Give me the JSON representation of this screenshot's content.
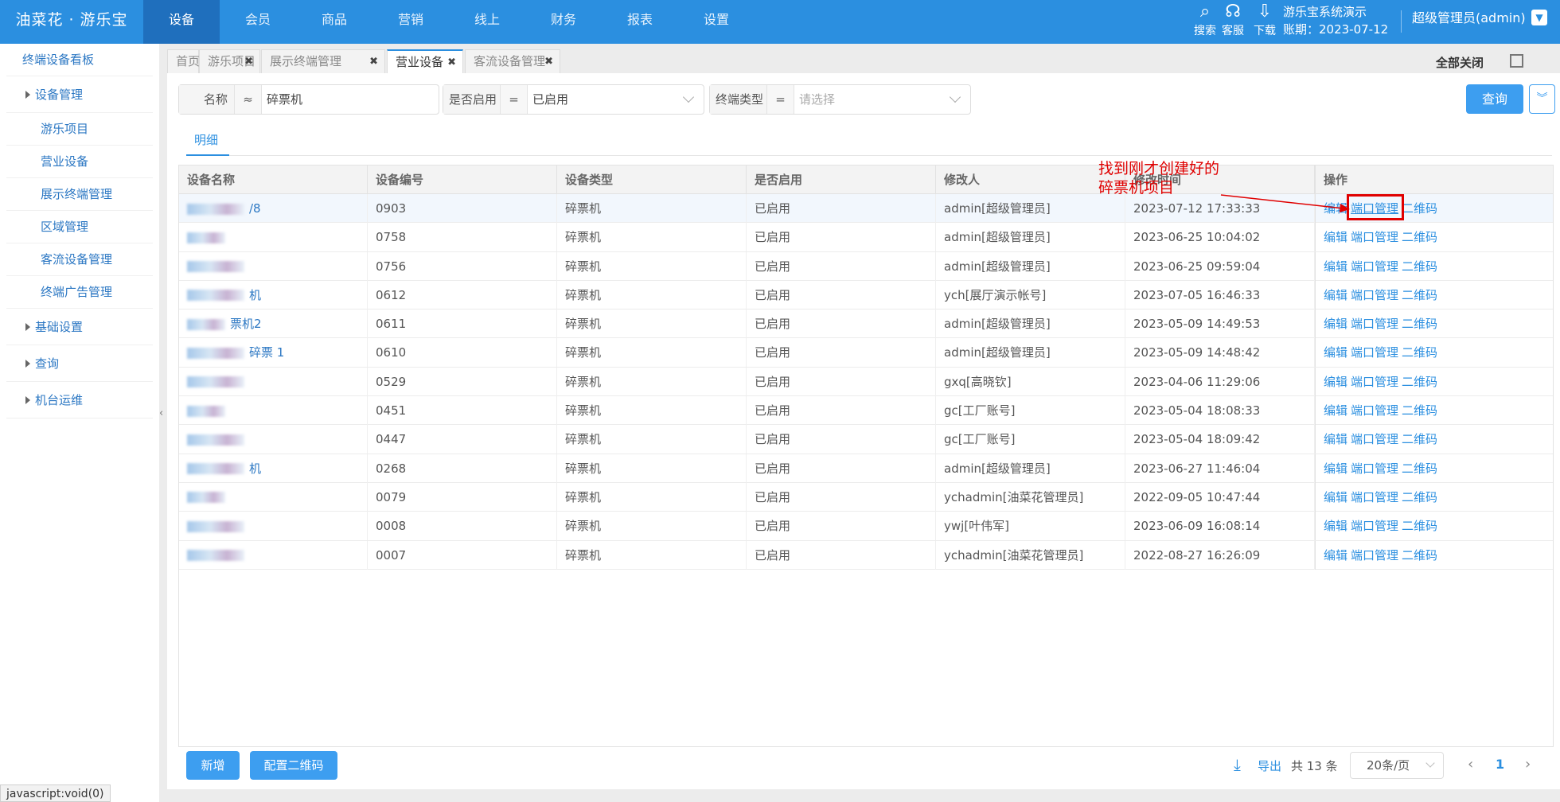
{
  "header": {
    "logo": "油菜花 · 游乐宝",
    "nav": [
      "设备",
      "会员",
      "商品",
      "营销",
      "线上",
      "财务",
      "报表",
      "设置"
    ],
    "active_nav": "设备",
    "tools": [
      {
        "icon": "search-icon",
        "label": "搜索"
      },
      {
        "icon": "headset-icon",
        "label": "客服"
      },
      {
        "icon": "download-icon",
        "label": "下载"
      }
    ],
    "system_name": "游乐宝系统演示",
    "account_period": "账期：2023-07-12",
    "user": "超级管理员(admin)"
  },
  "sidebar": {
    "items": [
      {
        "label": "终端设备看板",
        "type": "lvl0"
      },
      {
        "label": "设备管理",
        "type": "group"
      },
      {
        "label": "游乐项目",
        "type": "sub"
      },
      {
        "label": "营业设备",
        "type": "sub"
      },
      {
        "label": "展示终端管理",
        "type": "sub"
      },
      {
        "label": "区域管理",
        "type": "sub"
      },
      {
        "label": "客流设备管理",
        "type": "sub"
      },
      {
        "label": "终端广告管理",
        "type": "sub"
      },
      {
        "label": "基础设置",
        "type": "group"
      },
      {
        "label": "查询",
        "type": "group"
      },
      {
        "label": "机台运维",
        "type": "group"
      }
    ],
    "collapse_glyph": "‹"
  },
  "tabs": {
    "items": [
      {
        "label": "首页",
        "closable": false
      },
      {
        "label": "游乐项目",
        "closable": true
      },
      {
        "label": "展示终端管理",
        "closable": true
      },
      {
        "label": "营业设备",
        "closable": true,
        "active": true
      },
      {
        "label": "客流设备管理",
        "closable": true
      }
    ],
    "close_all": "全部关闭"
  },
  "filters": {
    "name": {
      "label": "名称",
      "op": "≈",
      "value": "碎票机"
    },
    "enabled": {
      "label": "是否启用",
      "op": "=",
      "value": "已启用"
    },
    "terminal_type": {
      "label": "终端类型",
      "op": "=",
      "placeholder": "请选择"
    },
    "query_button": "查询"
  },
  "detail_tab": "明细",
  "table": {
    "columns": [
      "设备名称",
      "设备编号",
      "设备类型",
      "是否启用",
      "修改人",
      "修改时间",
      "操作"
    ],
    "rows": [
      {
        "name": "/8",
        "code": "0903",
        "type": "碎票机",
        "enabled": "已启用",
        "modifier": "admin[超级管理员]",
        "time": "2023-07-12 17:33:33"
      },
      {
        "name": "",
        "code": "0758",
        "type": "碎票机",
        "enabled": "已启用",
        "modifier": "admin[超级管理员]",
        "time": "2023-06-25 10:04:02"
      },
      {
        "name": "",
        "code": "0756",
        "type": "碎票机",
        "enabled": "已启用",
        "modifier": "admin[超级管理员]",
        "time": "2023-06-25 09:59:04"
      },
      {
        "name": "机",
        "code": "0612",
        "type": "碎票机",
        "enabled": "已启用",
        "modifier": "ych[展厅演示帐号]",
        "time": "2023-07-05 16:46:33"
      },
      {
        "name": "票机2",
        "code": "0611",
        "type": "碎票机",
        "enabled": "已启用",
        "modifier": "admin[超级管理员]",
        "time": "2023-05-09 14:49:53"
      },
      {
        "name": "碎票 1",
        "code": "0610",
        "type": "碎票机",
        "enabled": "已启用",
        "modifier": "admin[超级管理员]",
        "time": "2023-05-09 14:48:42"
      },
      {
        "name": "",
        "code": "0529",
        "type": "碎票机",
        "enabled": "已启用",
        "modifier": "gxq[高晓钦]",
        "time": "2023-04-06 11:29:06"
      },
      {
        "name": "",
        "code": "0451",
        "type": "碎票机",
        "enabled": "已启用",
        "modifier": "gc[工厂账号]",
        "time": "2023-05-04 18:08:33"
      },
      {
        "name": "",
        "code": "0447",
        "type": "碎票机",
        "enabled": "已启用",
        "modifier": "gc[工厂账号]",
        "time": "2023-05-04 18:09:42"
      },
      {
        "name": "机",
        "code": "0268",
        "type": "碎票机",
        "enabled": "已启用",
        "modifier": "admin[超级管理员]",
        "time": "2023-06-27 11:46:04"
      },
      {
        "name": "",
        "code": "0079",
        "type": "碎票机",
        "enabled": "已启用",
        "modifier": "ychadmin[油菜花管理员]",
        "time": "2022-09-05 10:47:44"
      },
      {
        "name": "",
        "code": "0008",
        "type": "碎票机",
        "enabled": "已启用",
        "modifier": "ywj[叶伟军]",
        "time": "2023-06-09 16:08:14"
      },
      {
        "name": "",
        "code": "0007",
        "type": "碎票机",
        "enabled": "已启用",
        "modifier": "ychadmin[油菜花管理员]",
        "time": "2022-08-27 16:26:09"
      }
    ],
    "ops": [
      "编辑",
      "端口管理",
      "二维码"
    ]
  },
  "footer": {
    "add_button": "新增",
    "qr_button": "配置二维码",
    "export": "导出",
    "total": "共 13 条",
    "page_size": "20条/页",
    "page": "1"
  },
  "annotation": {
    "line1": "找到刚才创建好的",
    "line2": "碎票机项目",
    "color": "#e00000"
  },
  "status_bar": "javascript:void(0)"
}
